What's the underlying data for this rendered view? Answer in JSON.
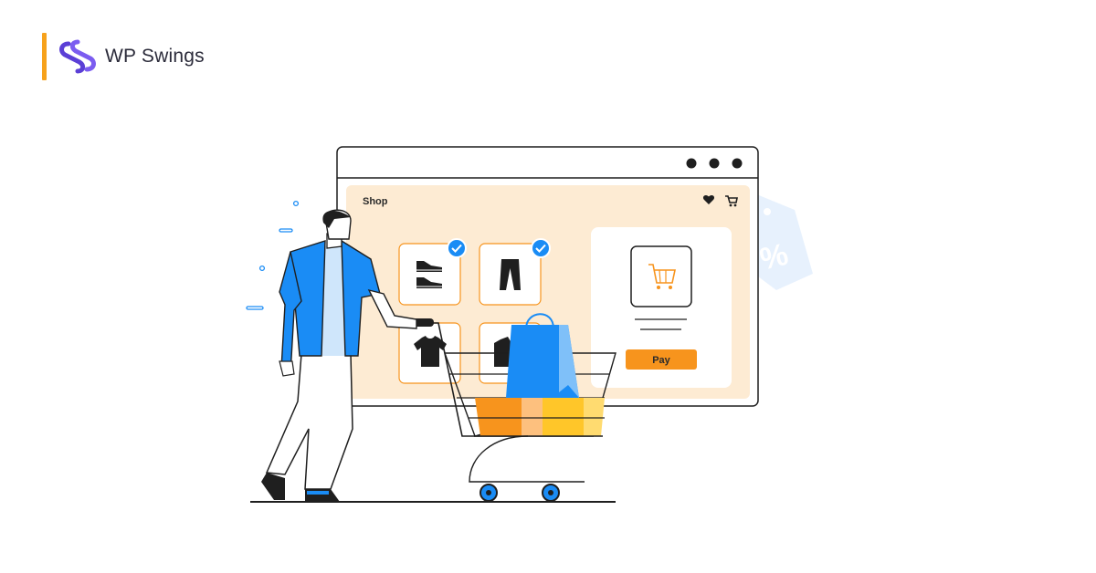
{
  "brand": {
    "name": "WP Swings",
    "accent": "#f7a21b",
    "logo_color": "#5b3fd6"
  },
  "browser": {
    "window_controls": [
      "dot-icon",
      "dot-icon",
      "dot-icon"
    ],
    "shop_label": "Shop",
    "header_icons": [
      "heart-icon",
      "cart-icon"
    ]
  },
  "products": [
    {
      "icon": "sneakers-icon",
      "checked": true
    },
    {
      "icon": "pants-icon",
      "checked": true
    },
    {
      "icon": "tshirt-icon",
      "checked": false
    },
    {
      "icon": "shirt-icon",
      "checked": false
    }
  ],
  "checkout": {
    "icon": "cart-icon",
    "pay_label": "Pay"
  },
  "decorations": {
    "tag_icon": "percent-tag-icon"
  },
  "colors": {
    "blue": "#1a8cf5",
    "orange": "#f7941d",
    "cream": "#fdebd3",
    "yellow": "#ffc629",
    "outline": "#1f1f1f"
  }
}
